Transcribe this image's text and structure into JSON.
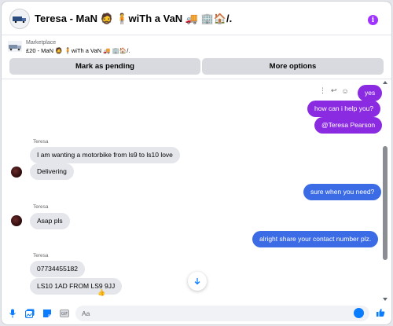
{
  "header": {
    "title": "Teresa - MaN 🧔 🧍wiTh a VaN 🚚 🏢🏠/.",
    "info_icon": "i"
  },
  "marketplace": {
    "label": "Marketplace",
    "title": "£20 - MaN 🧔 🧍wiTh a VaN 🚚 🏢🏠/.",
    "pending_label": "Mark as pending",
    "options_label": "More options"
  },
  "messages": [
    {
      "dir": "out",
      "text": "yes"
    },
    {
      "dir": "out",
      "text": "how can i help you?"
    },
    {
      "dir": "out",
      "text": "@Teresa Pearson"
    },
    {
      "dir": "in",
      "sender": "Teresa",
      "text": "I am wanting a motorbike from ls9 to ls10 love"
    },
    {
      "dir": "in",
      "text": "Delivering"
    },
    {
      "dir": "out",
      "text": "sure when you need?"
    },
    {
      "dir": "in",
      "sender": "Teresa",
      "text": "Asap pls"
    },
    {
      "dir": "out",
      "text": "alright share your contact number plz."
    },
    {
      "dir": "in",
      "sender": "Teresa",
      "text": "07734455182"
    },
    {
      "dir": "in",
      "text": "LS10 1AD FROM LS9 9JJ",
      "reaction": "👍"
    }
  ],
  "composer": {
    "placeholder": "Aa"
  },
  "colors": {
    "accent": "#8a2be2",
    "outgoing_blue": "#3b6ce6",
    "incoming": "#e4e6eb",
    "messenger_blue": "#0a7cff"
  },
  "icons": [
    "info-icon",
    "more-icon",
    "reply-icon",
    "react-icon",
    "scroll-down-arrow-icon",
    "microphone-icon",
    "gallery-icon",
    "sticker-icon",
    "gif-icon",
    "emoji-icon",
    "like-icon"
  ]
}
